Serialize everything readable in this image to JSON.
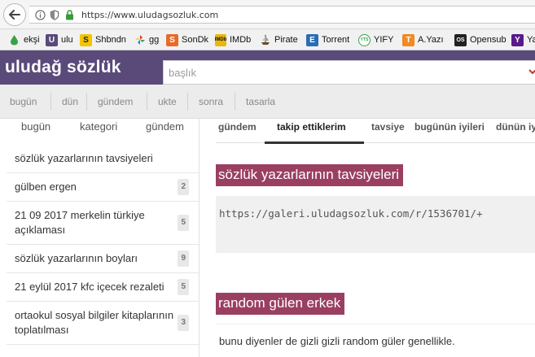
{
  "browser": {
    "url": "https://www.uludagsozluk.com",
    "bookmarks": [
      {
        "label": "ekşi",
        "icon": "drop-icon",
        "color": "#3aa14a"
      },
      {
        "label": "ulu",
        "icon": "u-icon",
        "color": "#5a4a7a"
      },
      {
        "label": "Shbndn",
        "icon": "s-icon",
        "color": "#f3c400"
      },
      {
        "label": "gg",
        "icon": "pinwheel-icon",
        "color": "#4caf50"
      },
      {
        "label": "SonDk",
        "icon": "s-icon",
        "color": "#e86a2a"
      },
      {
        "label": "IMDb",
        "icon": "imdb-icon",
        "color": "#e8b80c"
      },
      {
        "label": "Pirate",
        "icon": "ship-icon",
        "color": "#6b4b2b"
      },
      {
        "label": "Torrent",
        "icon": "e-icon",
        "color": "#2a6db4"
      },
      {
        "label": "YIFY",
        "icon": "yts-icon",
        "color": "#3aa14a"
      },
      {
        "label": "A.Yazı",
        "icon": "t-icon",
        "color": "#f08a24"
      },
      {
        "label": "Opensub",
        "icon": "os-icon",
        "color": "#222222"
      },
      {
        "label": "Ya",
        "icon": "y-icon",
        "color": "#5a1a8a"
      }
    ]
  },
  "site": {
    "logo": "uludağ sözlük",
    "search_placeholder": "başlık",
    "header_color": "#5a4a7a",
    "accent_color": "#9a3f62"
  },
  "topnav": [
    "bugün",
    "dün",
    "gündem",
    "ukte",
    "sonra",
    "tasarla"
  ],
  "left": {
    "tabs": [
      "bugün",
      "kategori",
      "gündem"
    ],
    "items": [
      {
        "title": "sözlük yazarlarının tavsiyeleri",
        "count": ""
      },
      {
        "title": "gülben ergen",
        "count": "2"
      },
      {
        "title": "21 09 2017 merkelin türkiye açıklaması",
        "count": "5"
      },
      {
        "title": "sözlük yazarlarının boyları",
        "count": "9"
      },
      {
        "title": "21 eylül 2017 kfc içecek rezaleti",
        "count": "5"
      },
      {
        "title": "ortaokul sosyal bilgiler kitaplarının toplatılması",
        "count": "3"
      }
    ]
  },
  "main": {
    "tabs": [
      "gündem",
      "takip ettiklerim",
      "tavsiye",
      "bugünün iyileri",
      "dünün iyileri"
    ],
    "active_tab": 1,
    "entries": [
      {
        "topic": "sözlük yazarlarının tavsiyeleri",
        "text": "https://galeri.uludagsozluk.com/r/1536701/+"
      },
      {
        "topic": "random gülen erkek",
        "text": "bunu diyenler de gizli gizli random güler genellikle."
      }
    ]
  }
}
